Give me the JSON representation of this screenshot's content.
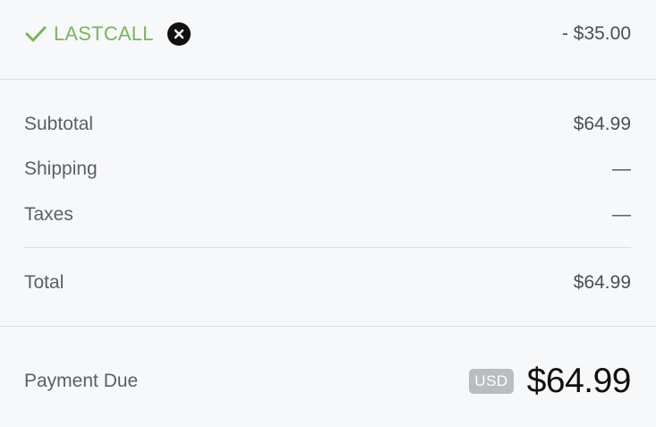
{
  "coupon": {
    "code": "LASTCALL",
    "discount": "- $35.00",
    "check_icon": "check-icon",
    "remove_icon": "close-icon",
    "accent_color": "#7bb55a"
  },
  "summary": {
    "subtotal_label": "Subtotal",
    "subtotal_value": "$64.99",
    "shipping_label": "Shipping",
    "shipping_value": "—",
    "taxes_label": "Taxes",
    "taxes_value": "—",
    "total_label": "Total",
    "total_value": "$64.99"
  },
  "payment": {
    "label": "Payment Due",
    "currency": "USD",
    "amount": "$64.99"
  }
}
